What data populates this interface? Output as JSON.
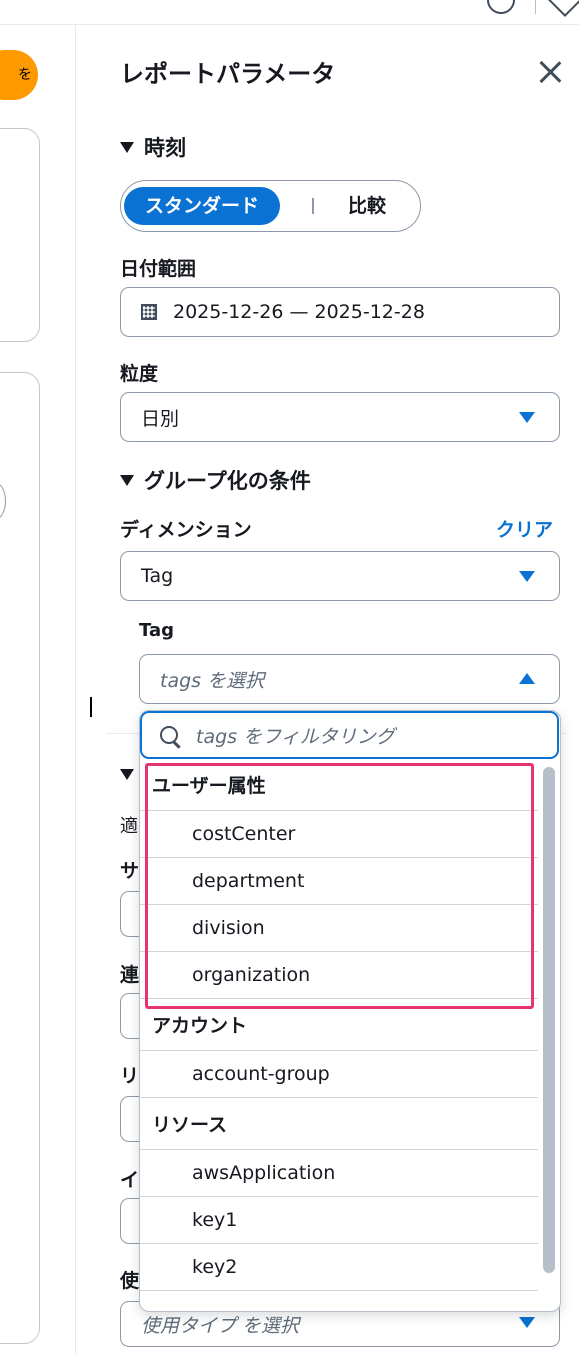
{
  "left": {
    "pill_label": "を"
  },
  "panel": {
    "title": "レポートパラメータ",
    "time_section": {
      "heading": "時刻",
      "seg_active": "スタンダード",
      "seg_other": "比較",
      "date_label": "日付範囲",
      "date_value": "2025-12-26 — 2025-12-28",
      "granularity_label": "粒度",
      "granularity_value": "日別"
    },
    "group_section": {
      "heading": "グループ化の条件",
      "dimension_label": "ディメンション",
      "clear_link": "クリア",
      "dimension_value": "Tag",
      "tag_label": "Tag",
      "tag_placeholder": "tags を選択"
    },
    "dropdown": {
      "filter_placeholder": "tags をフィルタリング",
      "groups": [
        {
          "heading": "ユーザー属性",
          "options": [
            "costCenter",
            "department",
            "division",
            "organization"
          ]
        },
        {
          "heading": "アカウント",
          "options": [
            "account-group"
          ]
        },
        {
          "heading": "リソース",
          "options": [
            "awsApplication",
            "key1",
            "key2"
          ]
        }
      ]
    },
    "background_fragments": [
      "適",
      "サ",
      "連",
      "リ",
      "イ",
      "使"
    ],
    "usage_type_placeholder": "使用タイプ を選択"
  },
  "colors": {
    "accent": "#0972d3",
    "highlight": "#e7336e",
    "orange": "#ff9900"
  }
}
